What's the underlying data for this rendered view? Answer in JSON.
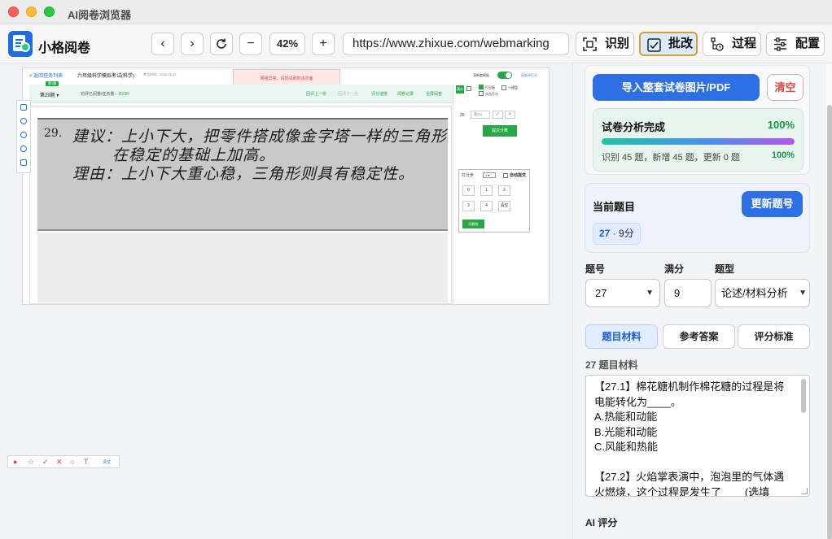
{
  "window": {
    "title": "AI阅卷浏览器"
  },
  "app": {
    "name": "小格阅卷"
  },
  "nav": {
    "back": "‹",
    "forward": "›",
    "zoom_out": "−",
    "zoom_in": "+",
    "zoom": "42%"
  },
  "url": "https://www.zhixue.com/webmarking",
  "toolbar": {
    "recognize": "识别",
    "grade": "批改",
    "process": "过程",
    "config": "配置"
  },
  "page": {
    "crumb": "< 返回任务列表",
    "exam_name": "六年级科学模拟考试(科学)",
    "exam_date": "考试时间：2026-05-22",
    "alert": "网络异常，请尝试刷新该页面",
    "switch_label": "清晰度模板",
    "prev_label": "历史评打分",
    "question_badge": "第1题",
    "question_select": "第29题",
    "count_label": "初评已阅量/任务量：",
    "count_value": "20/38",
    "links": [
      "回评上一份",
      "回评下一份",
      "评分进度",
      "阅卷记录",
      "全屏阅卷"
    ],
    "handwriting": {
      "qno": "29.",
      "line1": "建议：上小下大，把零件搭成像金字塔一样的三角形",
      "line2": "在稳定的基础上加高。",
      "line3": "理由：上小下大重心稳，三角形则具有稳定性。"
    },
    "score_tools": {
      "badge": "满分",
      "opt1": "打分板",
      "opt2": "小键盘",
      "opt3": "点击打分"
    },
    "q_no": "29",
    "score_placeholder": "满分4",
    "ok": "✓",
    "x": "×",
    "submit_score": "提交分数",
    "step": {
      "label": "打分步",
      "value": "1",
      "auto_submit": "自动提交",
      "keys": [
        "0",
        "1",
        "2",
        "3",
        "4",
        "清空"
      ],
      "submit": "问题卷"
    },
    "annotation_clear": "清空"
  },
  "panel": {
    "import_button": "导入整套试卷图片/PDF",
    "clear_button": "清空",
    "analysis_title": "试卷分析完成",
    "analysis_percent": "100%",
    "analysis_progress": 1.0,
    "analysis_stats": "识别 45 题，新增 45 题，更新 0 题",
    "analysis_percent2": "100%",
    "current_label": "当前题目",
    "update_button": "更新题号",
    "current_tag_no": "27",
    "current_tag_rest": " · 9分",
    "labels": {
      "qno": "题号",
      "full": "满分",
      "type": "题型"
    },
    "qno_value": "27",
    "full_value": "9",
    "type_value": "论述/材料分析",
    "tabs": [
      "题目材料",
      "参考答案",
      "评分标准"
    ],
    "material_label": "27 题目材料",
    "material_text": "【27.1】棉花糖机制作棉花糖的过程是将电能转化为____。\nA.热能和动能\nB.光能和动能\nC.风能和热能\n\n【27.2】火焰掌表演中，泡泡里的气体遇火燃烧，这个过程是发生了____(选填",
    "ai_label": "AI 评分"
  },
  "colors": {
    "accent": "#2f6fe5",
    "success": "#15924a",
    "danger": "#e04545",
    "grade_green": "#27a844",
    "active_border": "#d6a127"
  },
  "icons": [
    "logo-icon",
    "back-icon",
    "forward-icon",
    "reload-icon",
    "zoom-out-icon",
    "zoom-in-icon",
    "scan-icon",
    "grade-icon",
    "process-icon",
    "config-icon"
  ]
}
